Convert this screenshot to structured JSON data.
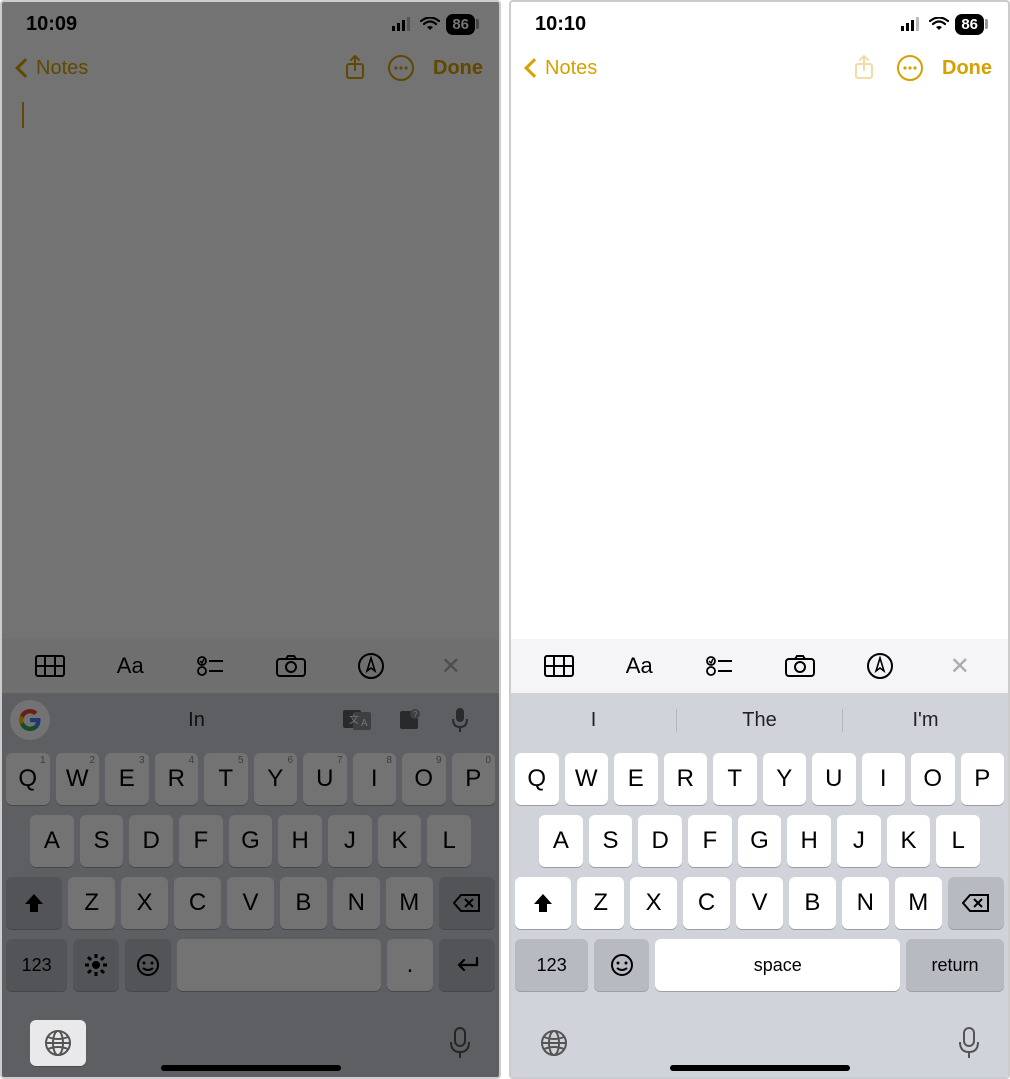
{
  "left": {
    "status": {
      "time": "10:09",
      "battery": "86"
    },
    "nav": {
      "back": "Notes",
      "done": "Done"
    },
    "format_bar": {
      "aa": "Aa"
    },
    "suggestions": {
      "g_label": "G",
      "text": "In"
    },
    "keyboard": {
      "row1": [
        "Q",
        "W",
        "E",
        "R",
        "T",
        "Y",
        "U",
        "I",
        "O",
        "P"
      ],
      "row1_hints": [
        "1",
        "2",
        "3",
        "4",
        "5",
        "6",
        "7",
        "8",
        "9",
        "0"
      ],
      "row2": [
        "A",
        "S",
        "D",
        "F",
        "G",
        "H",
        "J",
        "K",
        "L"
      ],
      "row3": [
        "Z",
        "X",
        "C",
        "V",
        "B",
        "N",
        "M"
      ],
      "num": "123",
      "period": "."
    }
  },
  "right": {
    "status": {
      "time": "10:10",
      "battery": "86"
    },
    "nav": {
      "back": "Notes",
      "done": "Done"
    },
    "format_bar": {
      "aa": "Aa"
    },
    "suggestions": [
      "I",
      "The",
      "I'm"
    ],
    "keyboard": {
      "row1": [
        "Q",
        "W",
        "E",
        "R",
        "T",
        "Y",
        "U",
        "I",
        "O",
        "P"
      ],
      "row2": [
        "A",
        "S",
        "D",
        "F",
        "G",
        "H",
        "J",
        "K",
        "L"
      ],
      "row3": [
        "Z",
        "X",
        "C",
        "V",
        "B",
        "N",
        "M"
      ],
      "num": "123",
      "space": "space",
      "return": "return"
    }
  }
}
